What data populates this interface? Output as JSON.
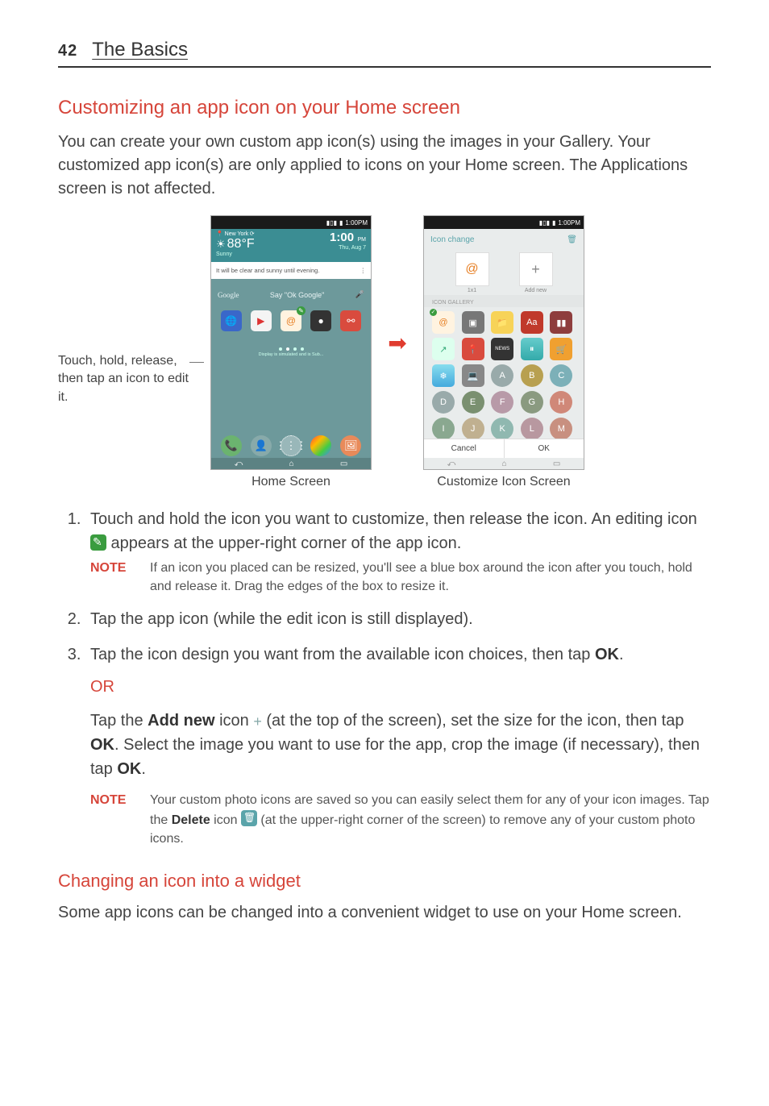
{
  "header": {
    "page_number": "42",
    "chapter": "The Basics"
  },
  "section1": {
    "heading": "Customizing an app icon on your Home screen",
    "intro": "You can create your own custom app icon(s) using the images in your Gallery. Your customized app icon(s) are only applied to icons on your Home screen. The Applications screen is not affected."
  },
  "figure": {
    "callout": "Touch, hold, release, then tap an icon to edit it.",
    "status_time": "1:00PM",
    "weather_city": "New York",
    "temp": "88°F",
    "sunny": "Sunny",
    "clock_time": "1:00",
    "clock_pm": "PM",
    "clock_date": "Thu, Aug 7",
    "forecast": "It will be clear and sunny until evening.",
    "google": "Google",
    "ok_google": "Say \"Ok Google\"",
    "pager_txt": "Display is simulated and is Sub...",
    "caption1": "Home Screen",
    "icon_change": "Icon change",
    "size_lbl": "1x1",
    "add_new": "Add new",
    "gallery_header": "ICON GALLERY",
    "cancel": "Cancel",
    "ok": "OK",
    "caption2": "Customize Icon Screen"
  },
  "steps": {
    "s1a": "Touch and hold the icon you want to customize, then release the icon. An editing icon ",
    "s1b": " appears at the upper-right corner of the app icon.",
    "note1_label": "NOTE",
    "note1": "If an icon you placed can be resized, you'll see a blue box around the icon after you touch, hold and release it. Drag the edges of the box to resize it.",
    "s2": "Tap the app icon (while the edit icon is still displayed).",
    "s3a": "Tap the icon design you want from the available icon choices, then tap ",
    "s3b": "OK",
    "s3c": ".",
    "or": "OR",
    "s3d_a": "Tap the ",
    "s3d_b": "Add new",
    "s3d_c": " icon ",
    "s3d_d": " (at the top of the screen), set the size for the icon, then tap ",
    "s3d_e": "OK",
    "s3d_f": ". Select the image you want to use for the app, crop the image (if necessary), then tap ",
    "s3d_g": "OK",
    "s3d_h": ".",
    "note2_label": "NOTE",
    "note2a": "Your custom photo icons are saved so you can easily select them for any of your icon images. Tap the ",
    "note2b": "Delete",
    "note2c": " icon ",
    "note2d": " (at the upper-right corner of the screen) to remove any of your custom photo icons."
  },
  "section2": {
    "heading": "Changing an icon into a widget",
    "body": "Some app icons can be changed into a convenient widget to use on your Home screen."
  }
}
